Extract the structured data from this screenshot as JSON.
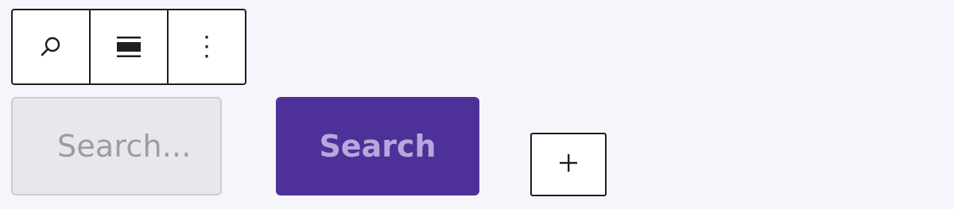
{
  "toolbar": {
    "buttons": [
      {
        "icon": "search-icon"
      },
      {
        "icon": "align-wide-icon"
      },
      {
        "icon": "more-vertical-icon"
      }
    ]
  },
  "search": {
    "placeholder": "Search...",
    "button_label": "Search"
  },
  "add_block": {
    "icon": "plus-icon"
  },
  "colors": {
    "background": "#f6f5fb",
    "button_bg": "#4d3198",
    "button_text": "#b6a8dd",
    "input_bg": "#e9e6ee",
    "placeholder_text": "#9f9ba4",
    "border_dark": "#1e1e1e"
  }
}
